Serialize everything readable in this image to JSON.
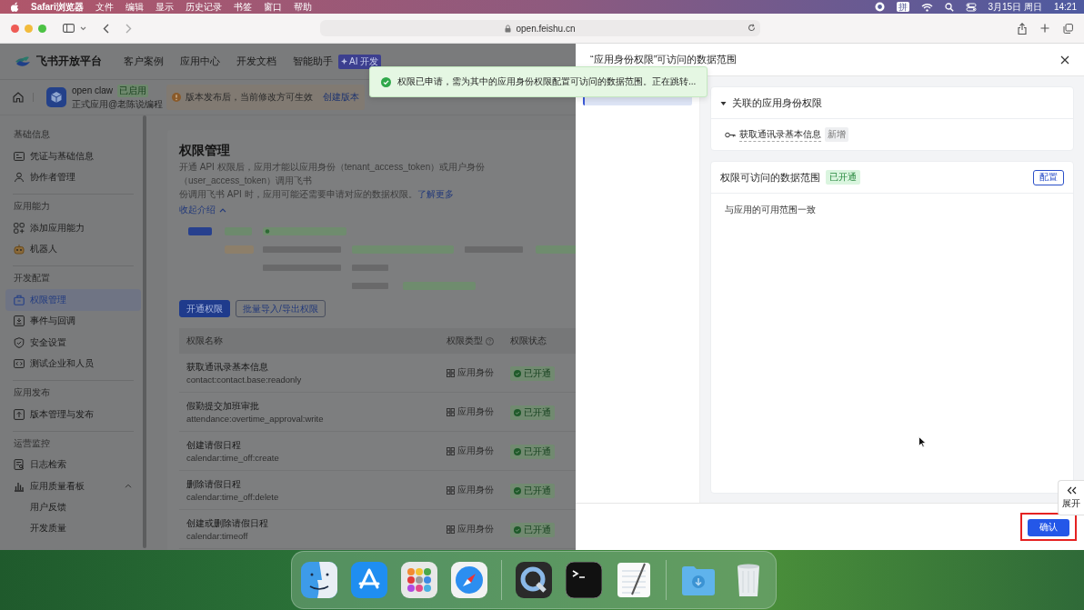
{
  "menu_bar": {
    "app": "Safari浏览器",
    "items": [
      "文件",
      "编辑",
      "显示",
      "历史记录",
      "书签",
      "窗口",
      "帮助"
    ],
    "input_method": "拼",
    "date": "3月15日 周日",
    "time": "14:21"
  },
  "browser": {
    "url": "open.feishu.cn"
  },
  "site_header": {
    "brand": "飞书开放平台",
    "nav": [
      {
        "label": "客户案例"
      },
      {
        "label": "应用中心"
      },
      {
        "label": "开发文档"
      },
      {
        "label": "智能助手",
        "badge": "AI 开发"
      }
    ]
  },
  "app_bar": {
    "name": "open claw",
    "status": "已启用",
    "owner": "正式应用@老陈说编程",
    "notice": "版本发布后，当前修改方可生效",
    "notice_link": "创建版本"
  },
  "sidebar": {
    "groups": [
      {
        "title": "基础信息",
        "items": [
          {
            "label": "凭证与基础信息",
            "selected": false
          },
          {
            "label": "协作者管理",
            "selected": false
          }
        ]
      },
      {
        "title": "应用能力",
        "items": [
          {
            "label": "添加应用能力",
            "selected": false
          },
          {
            "label": "机器人",
            "selected": false
          }
        ]
      },
      {
        "title": "开发配置",
        "items": [
          {
            "label": "权限管理",
            "selected": true
          },
          {
            "label": "事件与回调",
            "selected": false
          },
          {
            "label": "安全设置",
            "selected": false
          },
          {
            "label": "测试企业和人员",
            "selected": false
          }
        ]
      },
      {
        "title": "应用发布",
        "items": [
          {
            "label": "版本管理与发布",
            "selected": false
          }
        ]
      },
      {
        "title": "运营监控",
        "items": [
          {
            "label": "日志检索",
            "selected": false
          },
          {
            "label": "应用质量看板",
            "selected": false,
            "expanded": true,
            "children": [
              {
                "label": "用户反馈",
                "selected": false
              },
              {
                "label": "开发质量",
                "selected": false
              }
            ]
          }
        ]
      }
    ]
  },
  "main": {
    "title": "权限管理",
    "description": [
      "开通 API 权限后，应用才能以应用身份（tenant_access_token）或用户身份（user_access_token）调用飞书",
      "份调用飞书 API 时，应用可能还需要申请对应的数据权限。"
    ],
    "link": "了解更多",
    "collapse": "收起介绍",
    "buttons": [
      {
        "label": "开通权限",
        "kind": "primary"
      },
      {
        "label": "批量导入/导出权限",
        "kind": "outline"
      }
    ],
    "table": {
      "columns": [
        "权限名称",
        "权限类型",
        "权限状态"
      ],
      "rows": [
        {
          "name": "获取通讯录基本信息",
          "scope": "contact:contact.base:readonly",
          "type": "应用身份",
          "status": "已开通"
        },
        {
          "name": "假勤提交加班审批",
          "scope": "attendance:overtime_approval:write",
          "type": "应用身份",
          "status": "已开通"
        },
        {
          "name": "创建请假日程",
          "scope": "calendar:time_off:create",
          "type": "应用身份",
          "status": "已开通"
        },
        {
          "name": "删除请假日程",
          "scope": "calendar:time_off:delete",
          "type": "应用身份",
          "status": "已开通"
        },
        {
          "name": "创建或删除请假日程",
          "scope": "calendar:timeoff",
          "type": "应用身份",
          "status": "已开通"
        }
      ]
    }
  },
  "toast": {
    "message": "权限已申请，需为其中的应用身份权限配置可访问的数据范围。正在跳转..."
  },
  "drawer": {
    "title": "“应用身份权限”可访问的数据范围",
    "nav_items": [
      {
        "selected": true
      }
    ],
    "cards": [
      {
        "kind": "linked",
        "title": "关联的应用身份权限",
        "expanded": true,
        "items": [
          {
            "label": "获取通讯录基本信息",
            "tag": "新增"
          }
        ]
      },
      {
        "kind": "scope",
        "title": "权限可访问的数据范围",
        "status": "已开通",
        "action": "配置",
        "body": "与应用的可用范围一致"
      }
    ],
    "expand_tab": "展开",
    "confirm": "确认",
    "confirm_highlighted": true
  }
}
